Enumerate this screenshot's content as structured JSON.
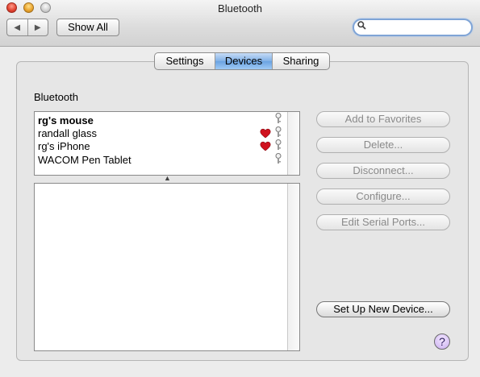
{
  "window": {
    "title": "Bluetooth"
  },
  "toolbar": {
    "show_all_label": "Show All",
    "search_placeholder": ""
  },
  "tabs": [
    {
      "label": "Settings",
      "selected": false
    },
    {
      "label": "Devices",
      "selected": true
    },
    {
      "label": "Sharing",
      "selected": false
    }
  ],
  "devices_section": {
    "label": "Bluetooth"
  },
  "devices": [
    {
      "name": "rg's mouse",
      "bold": true,
      "favorite": false,
      "paired": true
    },
    {
      "name": "randall glass",
      "bold": false,
      "favorite": true,
      "paired": true
    },
    {
      "name": "rg's iPhone",
      "bold": false,
      "favorite": true,
      "paired": true
    },
    {
      "name": "WACOM Pen Tablet",
      "bold": false,
      "favorite": false,
      "paired": true
    }
  ],
  "buttons": {
    "add_to_favorites": "Add to Favorites",
    "delete": "Delete...",
    "disconnect": "Disconnect...",
    "configure": "Configure...",
    "edit_serial_ports": "Edit Serial Ports...",
    "set_up_new_device": "Set Up New Device...",
    "help": "?"
  },
  "icons": {
    "close": "close-icon",
    "minimize": "minimize-icon",
    "zoom": "zoom-icon",
    "back": "back-arrow-icon",
    "forward": "forward-arrow-icon",
    "search": "magnifier-icon",
    "favorite": "heart-icon",
    "paired": "key-icon"
  },
  "colors": {
    "selected_tab": "#7fb0e6",
    "heart": "#d0121e",
    "search_focus": "#7fa4d6"
  }
}
